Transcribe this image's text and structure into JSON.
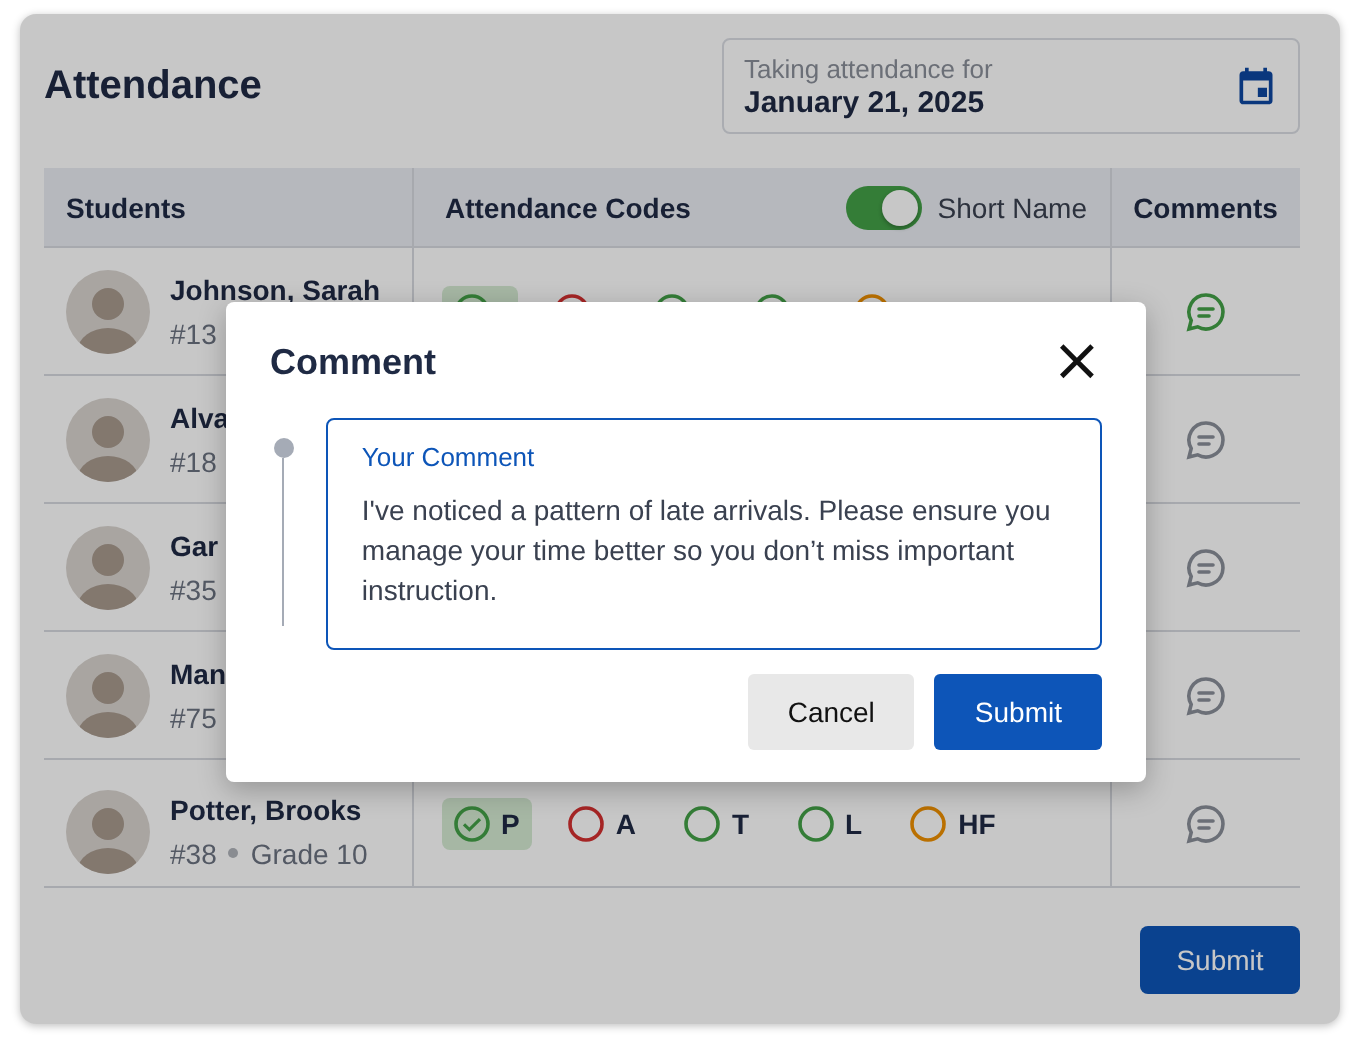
{
  "title": "Attendance",
  "date_field": {
    "label": "Taking attendance for",
    "value": "January 21, 2025"
  },
  "table": {
    "columns": {
      "students": "Students",
      "codes": "Attendance Codes",
      "comments": "Comments"
    },
    "short_name_toggle": {
      "label": "Short Name",
      "on": true
    },
    "rows": [
      {
        "name": "Johnson, Sarah",
        "number": "#13",
        "codes": [
          {
            "color": "#347d37",
            "selected": true
          },
          {
            "color": "#a52525",
            "selected": false
          },
          {
            "color": "#347d37",
            "selected": false
          },
          {
            "color": "#347d37",
            "selected": false
          },
          {
            "color": "#ba7000",
            "selected": false
          }
        ],
        "has_comment": true
      },
      {
        "name": "Alva",
        "number": "#18",
        "has_comment": false
      },
      {
        "name": "Gar",
        "number": "#35",
        "has_comment": false
      },
      {
        "name": "Man",
        "number": "#75",
        "has_comment": false
      },
      {
        "name": "Potter, Brooks",
        "number": "#38",
        "grade": "Grade 10",
        "codes": [
          {
            "label": "P",
            "color": "#347d37",
            "selected": true
          },
          {
            "label": "A",
            "color": "#a52525",
            "selected": false
          },
          {
            "label": "T",
            "color": "#347d37",
            "selected": false
          },
          {
            "label": "L",
            "color": "#347d37",
            "selected": false
          },
          {
            "label": "HF",
            "color": "#ba7000",
            "selected": false
          }
        ],
        "has_comment": false
      }
    ]
  },
  "submit_button": "Submit",
  "dialog": {
    "title": "Comment",
    "close": "×",
    "field_label": "Your Comment",
    "comment": "I've noticed a pattern of late arrivals. Please ensure you manage your time better so you don’t miss important instruction.",
    "buttons": [
      {
        "label": "Cancel",
        "kind": "secondary"
      },
      {
        "label": "Submit",
        "kind": "primary"
      }
    ]
  }
}
